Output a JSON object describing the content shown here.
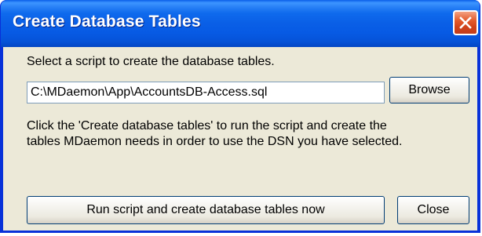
{
  "window": {
    "title": "Create Database Tables",
    "close_icon": "close-icon"
  },
  "dialog": {
    "select_prompt": "Select a script to create the database tables.",
    "script_path_value": "C:\\MDaemon\\App\\AccountsDB-Access.sql",
    "browse_label": "Browse",
    "instructions_line1": "Click the 'Create database tables' to run the script and create the",
    "instructions_line2": "tables MDaemon needs in order to use the DSN you have selected.",
    "run_label": "Run script and create database tables now",
    "close_label": "Close"
  },
  "colors": {
    "titlebar_blue": "#0a5fe6",
    "dialog_face": "#ece9d8",
    "close_red": "#e35b2c"
  }
}
